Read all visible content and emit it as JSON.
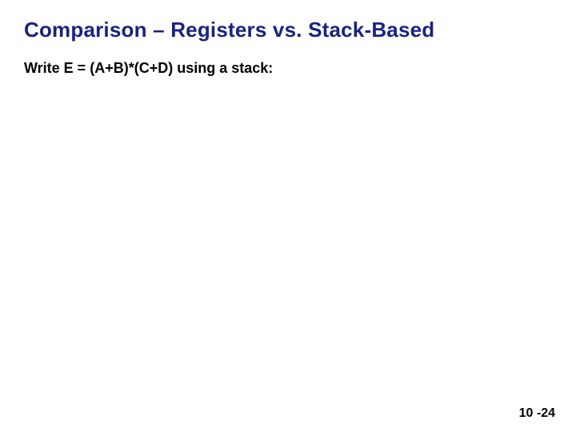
{
  "slide": {
    "title": "Comparison – Registers vs. Stack-Based",
    "body": "Write E = (A+B)*(C+D) using a stack:",
    "page_number": "10 -24"
  }
}
